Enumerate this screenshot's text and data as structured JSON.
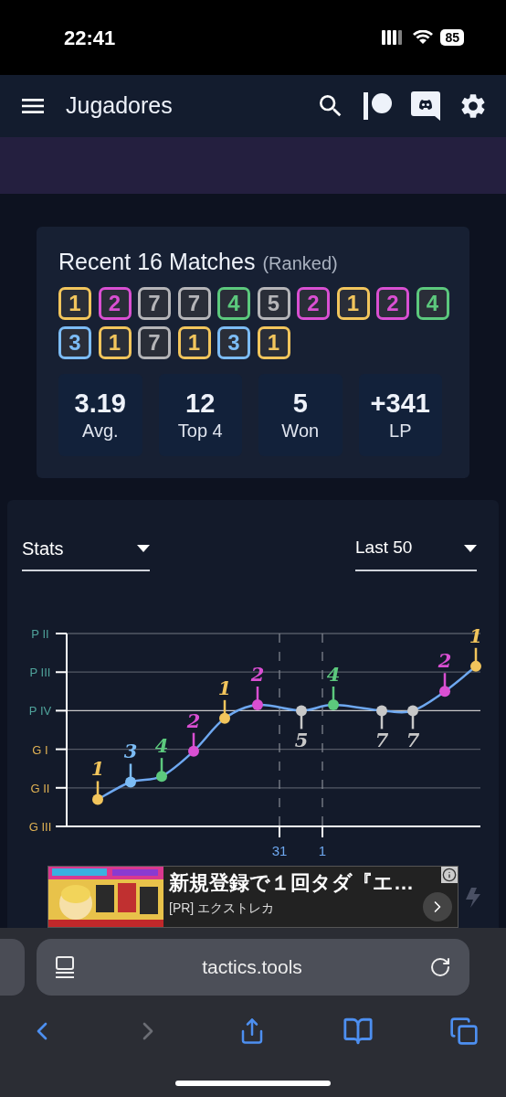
{
  "status_bar": {
    "time": "22:41",
    "battery": "85"
  },
  "header": {
    "title": "Jugadores"
  },
  "recent": {
    "title": "Recent 16 Matches",
    "subtitle": "(Ranked)",
    "matches": [
      {
        "place": "1",
        "color": "#f2c55c"
      },
      {
        "place": "2",
        "color": "#d94fd2"
      },
      {
        "place": "7",
        "color": "#b5b5b8"
      },
      {
        "place": "7",
        "color": "#b5b5b8"
      },
      {
        "place": "4",
        "color": "#5cc97d"
      },
      {
        "place": "5",
        "color": "#b5b5b8"
      },
      {
        "place": "2",
        "color": "#d94fd2"
      },
      {
        "place": "1",
        "color": "#f2c55c"
      },
      {
        "place": "2",
        "color": "#d94fd2"
      },
      {
        "place": "4",
        "color": "#5cc97d"
      },
      {
        "place": "3",
        "color": "#7cbcf5"
      },
      {
        "place": "1",
        "color": "#f2c55c"
      },
      {
        "place": "7",
        "color": "#b5b5b8"
      },
      {
        "place": "1",
        "color": "#f2c55c"
      },
      {
        "place": "3",
        "color": "#7cbcf5"
      },
      {
        "place": "1",
        "color": "#f2c55c"
      }
    ],
    "stats": [
      {
        "value": "3.19",
        "label": "Avg."
      },
      {
        "value": "12",
        "label": "Top 4"
      },
      {
        "value": "5",
        "label": "Won"
      },
      {
        "value": "+341",
        "label": "LP"
      }
    ]
  },
  "chart_panel": {
    "stat_select": "Stats",
    "range_select": "Last 50",
    "tier_labels": [
      {
        "label": "P II",
        "color": "#4fa39b"
      },
      {
        "label": "P III",
        "color": "#4fa39b"
      },
      {
        "label": "P IV",
        "color": "#4fa39b"
      },
      {
        "label": "G I",
        "color": "#e0b254"
      },
      {
        "label": "G II",
        "color": "#e0b254"
      },
      {
        "label": "G III",
        "color": "#e0b254"
      }
    ],
    "date_labels": [
      {
        "label": "31"
      },
      {
        "label": "1"
      }
    ],
    "placements": [
      {
        "label": "1",
        "color": "#f2c55c",
        "kind": "above"
      },
      {
        "label": "3",
        "color": "#7cbcf5",
        "kind": "above"
      },
      {
        "label": "4",
        "color": "#5cc97d",
        "kind": "above"
      },
      {
        "label": "2",
        "color": "#d94fd2",
        "kind": "above"
      },
      {
        "label": "1",
        "color": "#f2c55c",
        "kind": "above"
      },
      {
        "label": "2",
        "color": "#d94fd2",
        "kind": "above"
      },
      {
        "label": "5",
        "color": "#c8c8c8",
        "kind": "below"
      },
      {
        "label": "4",
        "color": "#5cc97d",
        "kind": "above"
      },
      {
        "label": "7",
        "color": "#c8c8c8",
        "kind": "below"
      },
      {
        "label": "7",
        "color": "#c8c8c8",
        "kind": "below"
      },
      {
        "label": "2",
        "color": "#d94fd2",
        "kind": "above"
      },
      {
        "label": "1",
        "color": "#f2c55c",
        "kind": "above"
      }
    ],
    "ad": {
      "kind": "picture",
      "title": "新規登録で１回タダ『エ…",
      "sponsor": "[PR] エクストレカ"
    }
  },
  "browser": {
    "url": "tactics.tools",
    "forward_disabled": true
  }
}
